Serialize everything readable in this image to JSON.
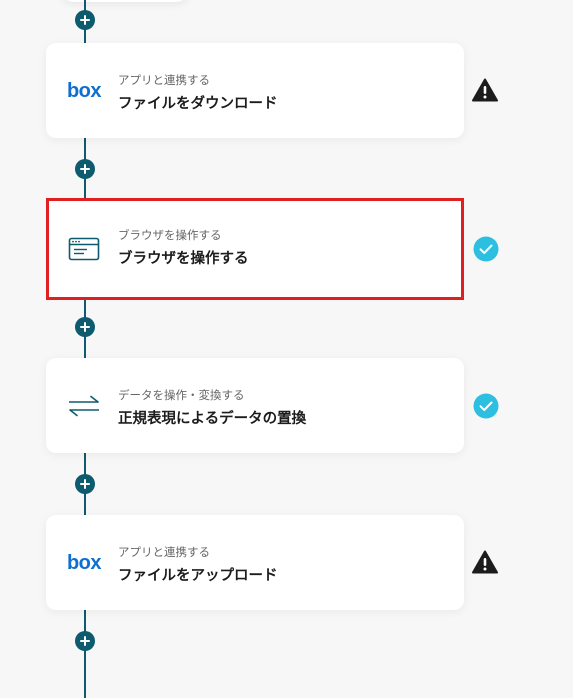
{
  "colors": {
    "connector": "#0e5a6e",
    "highlight": "#e02020",
    "success": "#2dbfe0",
    "warning": "#1c1c1c",
    "box_brand": "#0f6fd0"
  },
  "add_step_icon": "plus-icon",
  "steps": [
    {
      "icon": "box-logo",
      "logo_text": "box",
      "subtitle": "アプリと連携する",
      "title": "ファイルをダウンロード",
      "status": "warning"
    },
    {
      "icon": "browser-icon",
      "subtitle": "ブラウザを操作する",
      "title": "ブラウザを操作する",
      "status": "success",
      "highlighted": true
    },
    {
      "icon": "swap-arrows-icon",
      "subtitle": "データを操作・変換する",
      "title": "正規表現によるデータの置換",
      "status": "success"
    },
    {
      "icon": "box-logo",
      "logo_text": "box",
      "subtitle": "アプリと連携する",
      "title": "ファイルをアップロード",
      "status": "warning"
    }
  ]
}
